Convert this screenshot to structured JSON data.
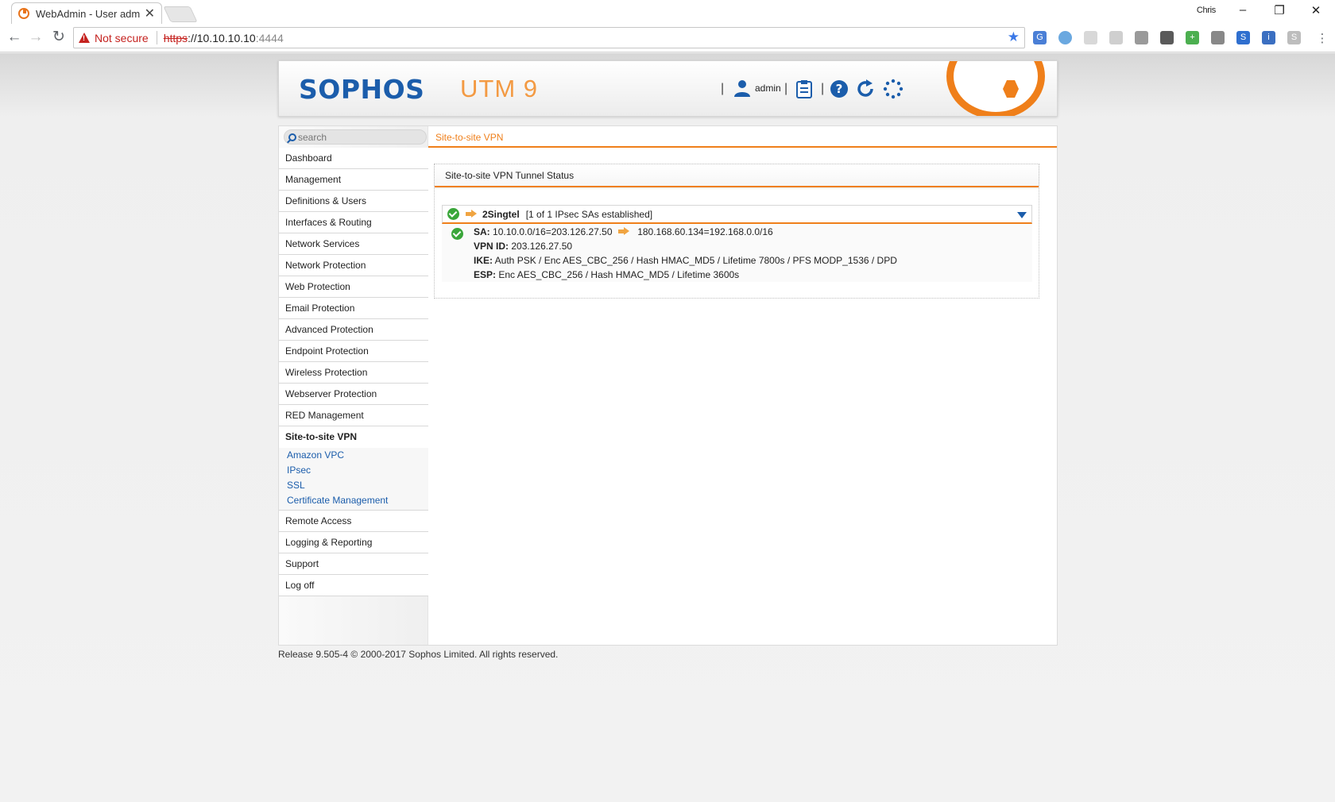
{
  "browser": {
    "tab_title": "WebAdmin - User admin",
    "tab_close": "✕",
    "window_user": "Chris",
    "url_scheme": "https",
    "url_sep": "://",
    "url_host": "10.10.10.10",
    "url_port": ":4444",
    "not_secure_label": "Not secure"
  },
  "header": {
    "logo": "SOPHOS",
    "product": "UTM 9",
    "user": "admin"
  },
  "sidebar": {
    "search_placeholder": "search",
    "items": [
      "Dashboard",
      "Management",
      "Definitions & Users",
      "Interfaces & Routing",
      "Network Services",
      "Network Protection",
      "Web Protection",
      "Email Protection",
      "Advanced Protection",
      "Endpoint Protection",
      "Wireless Protection",
      "Webserver Protection",
      "RED Management"
    ],
    "active_item": "Site-to-site VPN",
    "subitems": [
      "Amazon VPC",
      "IPsec",
      "SSL",
      "Certificate Management"
    ],
    "items_after": [
      "Remote Access",
      "Logging & Reporting",
      "Support",
      "Log off"
    ]
  },
  "content": {
    "breadcrumb": "Site-to-site VPN",
    "panel_title": "Site-to-site VPN Tunnel Status",
    "tunnel": {
      "name": "2Singtel",
      "status": "[1 of 1 IPsec SAs established]",
      "sa_label": "SA:",
      "sa_left": "10.10.0.0/16=203.126.27.50",
      "sa_right": "180.168.60.134=192.168.0.0/16",
      "vpnid_label": "VPN ID:",
      "vpnid_value": "203.126.27.50",
      "ike_label": "IKE:",
      "ike_value": "Auth PSK / Enc AES_CBC_256 / Hash HMAC_MD5 / Lifetime 7800s / PFS MODP_1536 / DPD",
      "esp_label": "ESP:",
      "esp_value": "Enc AES_CBC_256 / Hash HMAC_MD5 / Lifetime 3600s"
    }
  },
  "footer": "Release 9.505-4  © 2000-2017 Sophos Limited. All rights reserved.",
  "colors": {
    "brand_blue": "#1b5dab",
    "accent_orange": "#ef7f1a",
    "ok_green": "#3aa63a",
    "insecure_red": "#c5221f"
  }
}
